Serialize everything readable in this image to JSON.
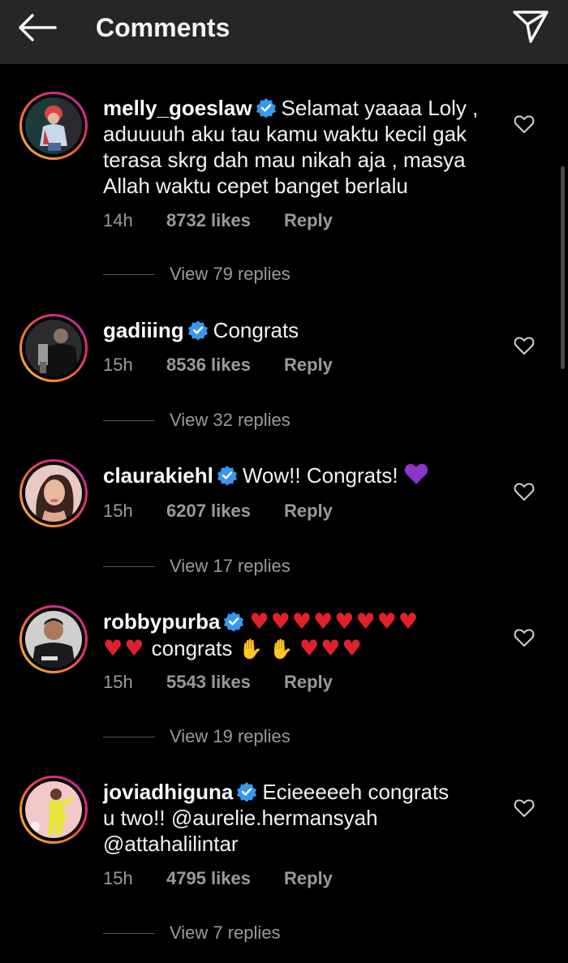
{
  "header": {
    "title": "Comments"
  },
  "comments": [
    {
      "username": "melly_goeslaw",
      "lines": [
        "Selamat yaaaa Loly ,",
        "aduuuuh aku tau kamu waktu kecil gak",
        "terasa skrg dah mau nikah aja , masya",
        "Allah waktu cepet banget berlalu"
      ],
      "time": "14h",
      "likes": "8732 likes",
      "reply": "Reply",
      "view_replies": "View 79 replies"
    },
    {
      "username": "gadiiing",
      "text": "Congrats",
      "time": "15h",
      "likes": "8536 likes",
      "reply": "Reply",
      "view_replies": "View 32 replies"
    },
    {
      "username": "claurakiehl",
      "text": "Wow!! Congrats!",
      "time": "15h",
      "likes": "6207 likes",
      "reply": "Reply",
      "view_replies": "View 17 replies"
    },
    {
      "username": "robbypurba",
      "text": "congrats",
      "time": "15h",
      "likes": "5543 likes",
      "reply": "Reply",
      "view_replies": "View 19 replies"
    },
    {
      "username": "joviadhiguna",
      "lines": [
        "Ecieeeeeh congrats",
        "u two!! @aurelie.hermansyah",
        "@attahalilintar"
      ],
      "time": "15h",
      "likes": "4795 likes",
      "reply": "Reply",
      "view_replies": "View 7 replies"
    }
  ],
  "icons": {
    "back": "arrow-left-icon",
    "send": "paper-plane-icon",
    "verified": "verified-badge-icon",
    "heart": "heart-outline-icon"
  },
  "colors": {
    "background": "#000000",
    "topbar": "#262626",
    "verified": "#3897f0",
    "muted": "#9a9a9a"
  }
}
